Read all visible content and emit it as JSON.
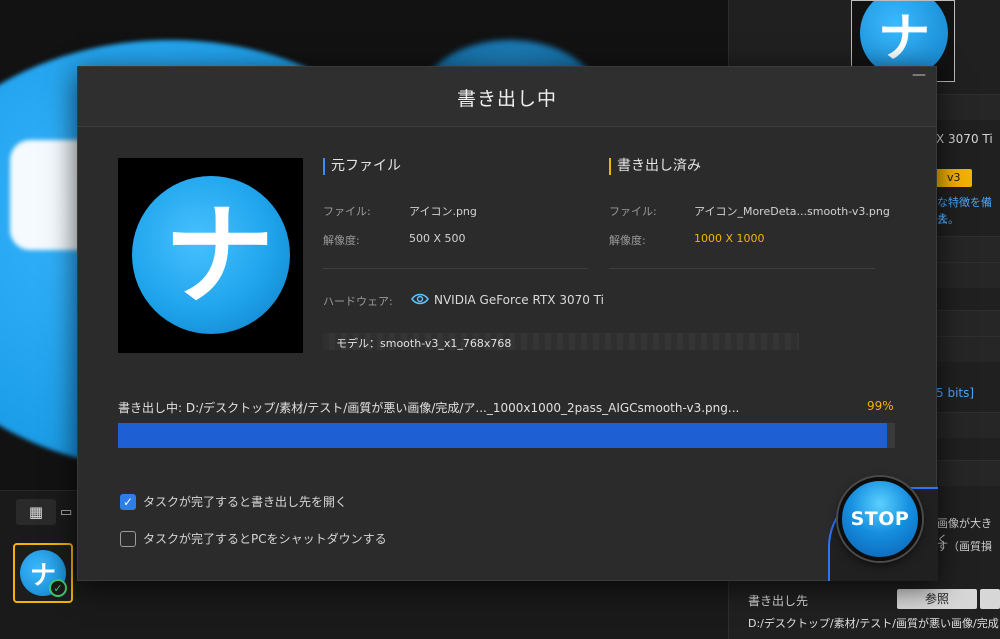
{
  "modal": {
    "title": "書き出し中",
    "minimize_icon": "minimize-icon",
    "source": {
      "heading": "元ファイル",
      "file_label": "ファイル:",
      "file_value": "アイコン.png",
      "res_label": "解像度:",
      "res_value": "500 X 500"
    },
    "output": {
      "heading": "書き出し済み",
      "file_label": "ファイル:",
      "file_value": "アイコン_MoreDeta...smooth-v3.png",
      "res_label": "解像度:",
      "res_value": "1000 X 1000"
    },
    "hardware_label": "ハードウェア:",
    "hardware_value": "NVIDIA GeForce RTX 3070 Ti",
    "model_text": "モデル：smooth-v3_x1_768x768",
    "progress": {
      "label": "書き出し中:  D:/デスクトップ/素材/テスト/画質が悪い画像/完成/ア..._1000x1000_2pass_AIGCsmooth-v3.png...",
      "percent_text": "99%",
      "fraction": 0.99
    },
    "options": [
      {
        "label": "タスクが完了すると書き出し先を開く",
        "checked": true
      },
      {
        "label": "タスクが完了するとPCをシャットダウンする",
        "checked": false
      }
    ],
    "stop_label": "STOP",
    "preview_glyph": "ナ"
  },
  "background": {
    "right_panel": {
      "gpu_fragment": "X 3070 Ti",
      "model_badge": "v3",
      "blue_line1": "な特徴を備え",
      "blue_line2": "去。",
      "bits_fragment": "5 bits]",
      "jp_line1": "画像が大きく",
      "jp_line2": "す（画質損",
      "output_label": "書き出し先",
      "browse_label": "参照",
      "output_path": "D:/デスクトップ/素材/テスト/画質が悪い画像/完成"
    },
    "bottom": {
      "grid_icon": "grid-view-icon",
      "list_icon": "list-view-icon",
      "thumb_glyph": "ナ",
      "check_glyph": "✓"
    }
  },
  "colors": {
    "accent_orange": "#f3b300",
    "accent_blue": "#2f7de8",
    "progress_fill": "#1f5fd4"
  }
}
